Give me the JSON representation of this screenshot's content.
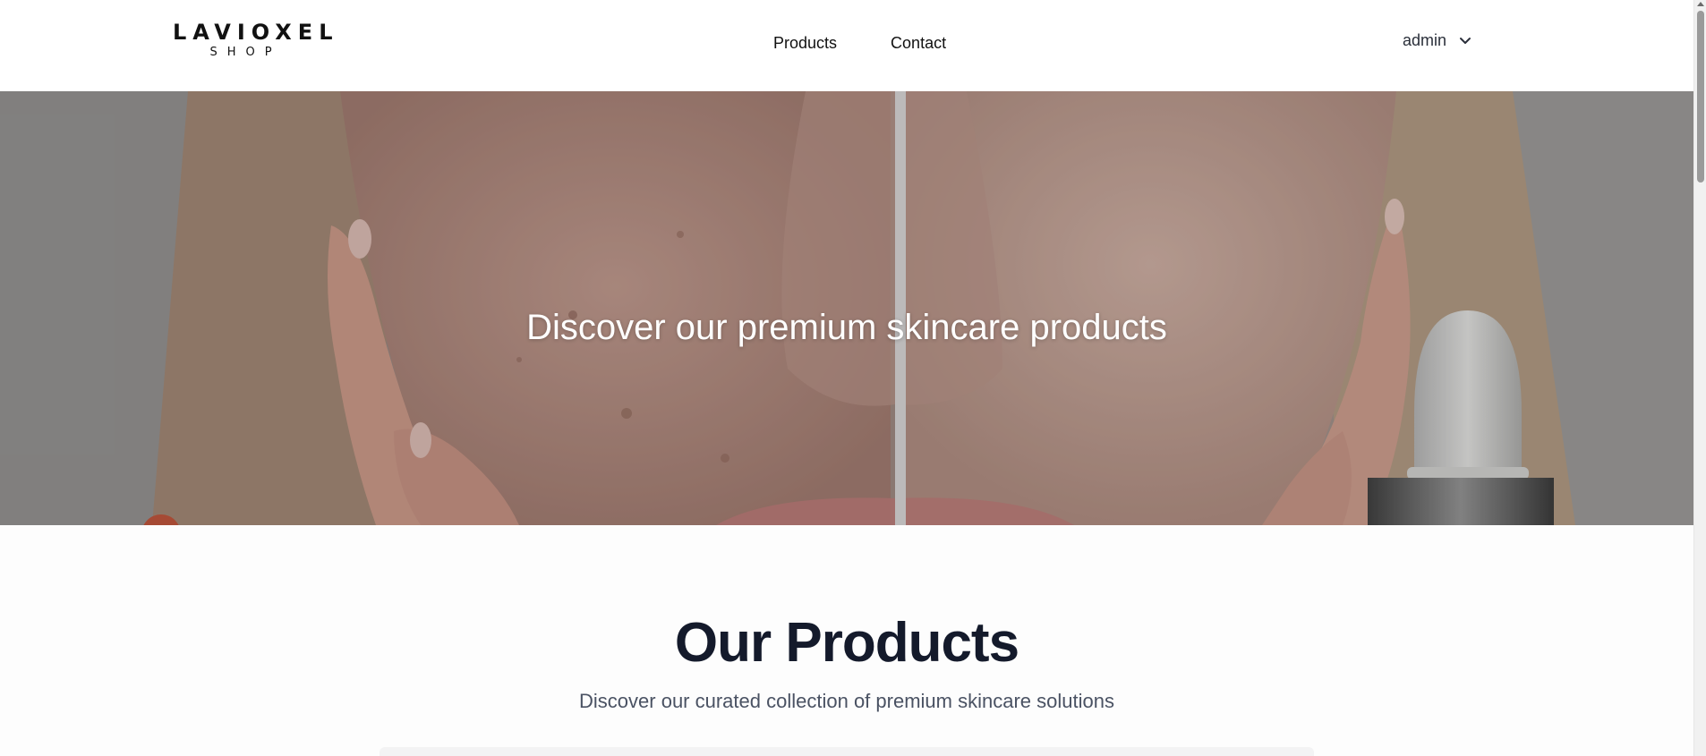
{
  "header": {
    "logo": {
      "word": "LAVIOXEL",
      "sub": "SHOP"
    },
    "nav": [
      {
        "label": "Products"
      },
      {
        "label": "Contact"
      }
    ],
    "user": {
      "name": "admin",
      "icon": "chevron-down-icon"
    }
  },
  "hero": {
    "title": "Discover our premium skincare products"
  },
  "products_section": {
    "title": "Our Products",
    "subtitle": "Discover our curated collection of premium skincare solutions"
  },
  "colors": {
    "text_dark": "#141a2b",
    "text_muted": "#4a5263",
    "hero_text": "#ffffff"
  }
}
